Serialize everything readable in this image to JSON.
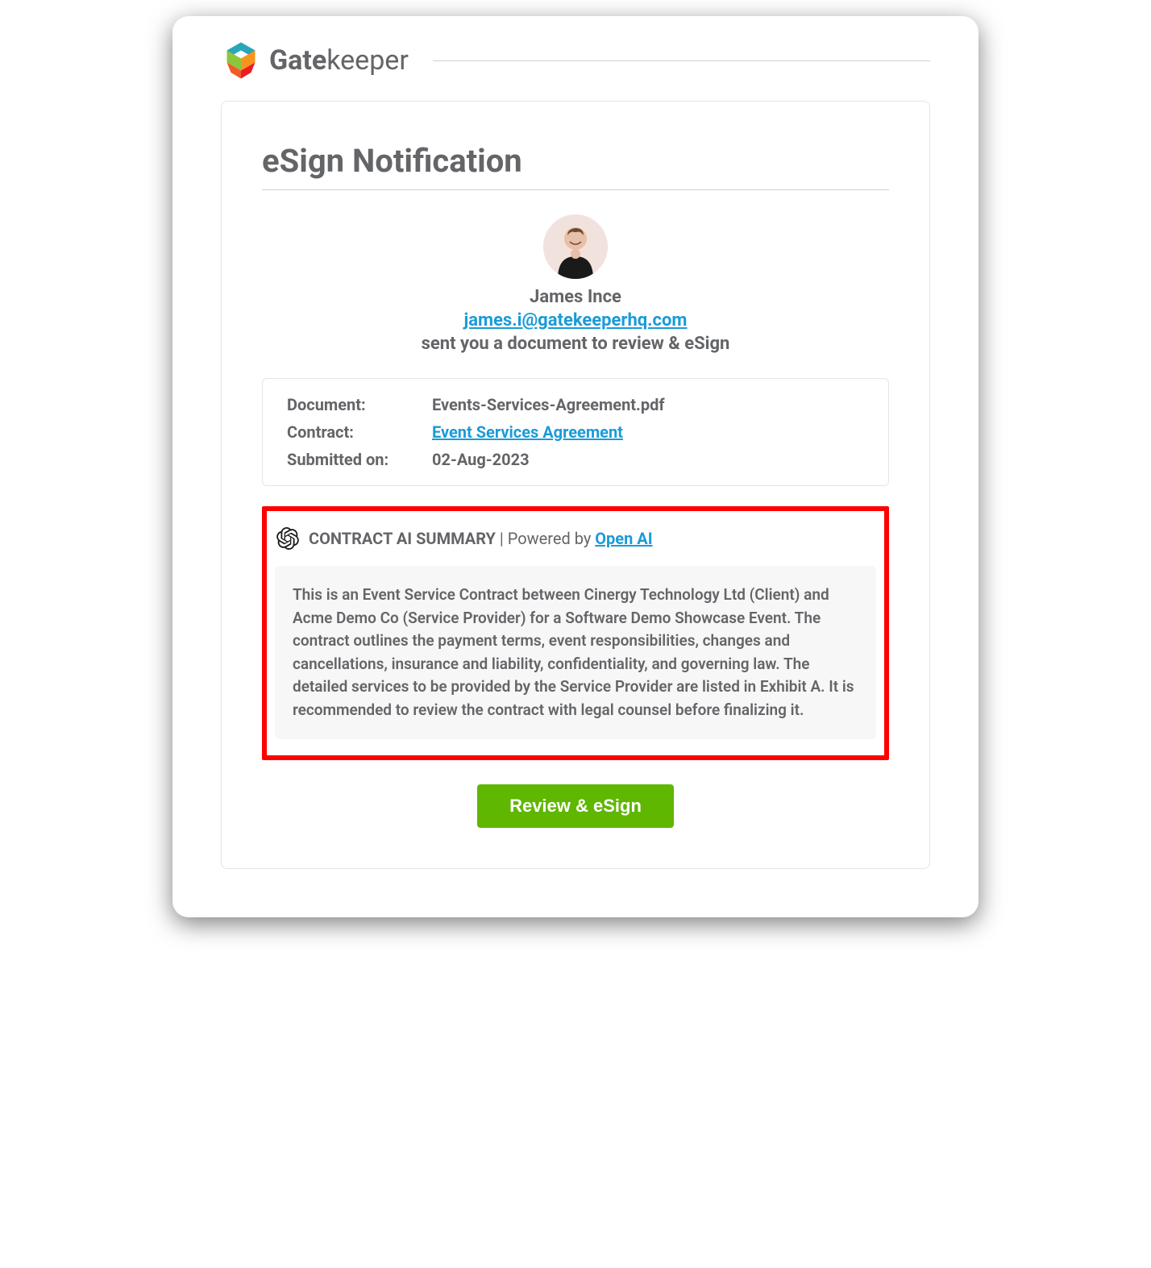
{
  "brand": {
    "name_bold": "Gate",
    "name_light": "keeper"
  },
  "notification": {
    "title": "eSign Notification",
    "sender_name": "James Ince",
    "sender_email": "james.i@gatekeeperhq.com",
    "sent_text": "sent you a document to review & eSign"
  },
  "details": {
    "document_label": "Document:",
    "document_value": "Events-Services-Agreement.pdf",
    "contract_label": "Contract:",
    "contract_value": "Event Services Agreement",
    "submitted_label": "Submitted on:",
    "submitted_value": "02-Aug-2023"
  },
  "ai_summary": {
    "header_prefix": "CONTRACT AI SUMMARY",
    "header_divider": " | ",
    "powered_by_text": "Powered by ",
    "powered_by_link": "Open AI",
    "body": "This is an Event Service Contract between Cinergy Technology Ltd (Client) and Acme Demo Co (Service Provider) for a Software Demo Showcase Event. The contract outlines the payment terms, event responsibilities, changes and cancellations, insurance and liability, confidentiality, and governing law. The detailed services to be provided by the Service Provider are listed in Exhibit A. It is recommended to review the contract with legal counsel before finalizing it."
  },
  "cta": {
    "label": "Review & eSign"
  }
}
